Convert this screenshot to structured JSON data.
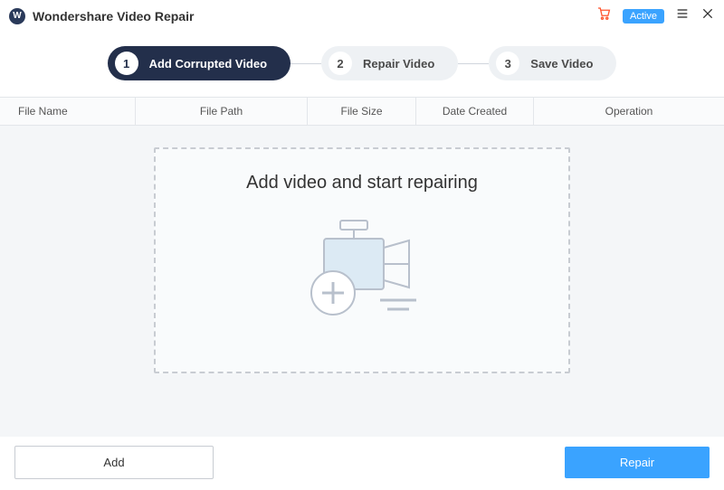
{
  "app": {
    "title": "Wondershare Video Repair",
    "logo_letter": "W",
    "active_badge": "Active"
  },
  "stepper": {
    "steps": [
      {
        "num": "1",
        "label": "Add Corrupted Video"
      },
      {
        "num": "2",
        "label": "Repair Video"
      },
      {
        "num": "3",
        "label": "Save Video"
      }
    ]
  },
  "table": {
    "columns": {
      "name": "File Name",
      "path": "File Path",
      "size": "File Size",
      "date": "Date Created",
      "op": "Operation"
    }
  },
  "dropzone": {
    "text": "Add video and start repairing"
  },
  "footer": {
    "add_label": "Add",
    "repair_label": "Repair"
  }
}
